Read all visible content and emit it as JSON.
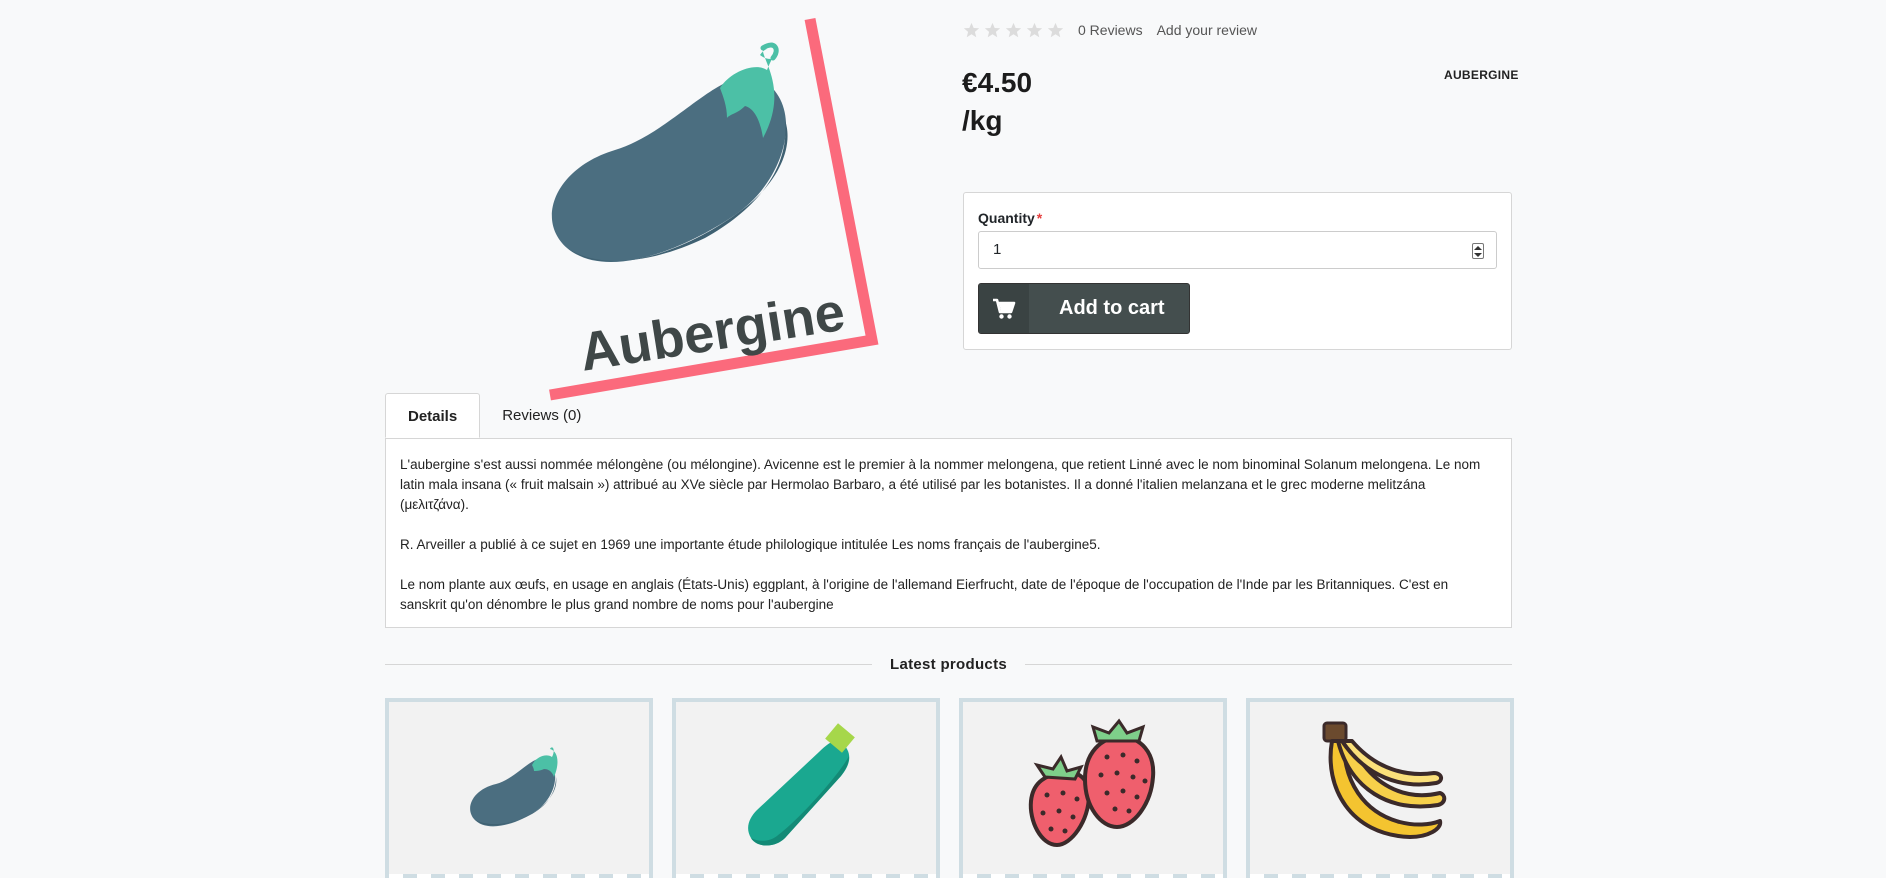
{
  "product": {
    "name": "Aubergine",
    "image_label": "Aubergine",
    "price": "€4.50",
    "price_unit": "/kg",
    "sku": "AUBERGINE"
  },
  "rating": {
    "stars_filled": 0,
    "stars_total": 5,
    "reviews_text": "0 Reviews",
    "add_review_text": "Add your review"
  },
  "cart": {
    "quantity_label": "Quantity",
    "required_marker": "*",
    "quantity_value": "1",
    "add_button_label": "Add to cart"
  },
  "tabs": [
    {
      "label": "Details",
      "active": true
    },
    {
      "label": "Reviews (0)",
      "active": false
    }
  ],
  "details": {
    "paragraphs": [
      "L'aubergine s'est aussi nommée mélongène (ou mélongine). Avicenne est le premier à la nommer melongena, que retient Linné avec le nom binominal Solanum melongena. Le nom latin mala insana (« fruit malsain ») attribué au XVe siècle par Hermolao Barbaro, a été utilisé par les botanistes. Il a donné l'italien melanzana et le grec moderne melitzána (μελιτζάνα).",
      "R. Arveiller a publié à ce sujet en 1969 une importante étude philologique intitulée Les noms français de l'aubergine5.",
      "Le nom plante aux œufs, en usage en anglais (États-Unis) eggplant, à l'origine de l'allemand Eierfrucht, date de l'époque de l'occupation de l'Inde par les Britanniques. C'est en sanskrit qu'on dénombre le plus grand nombre de noms pour l'aubergine"
    ]
  },
  "latest_products": {
    "title": "Latest products",
    "items": [
      {
        "icon": "aubergine-icon"
      },
      {
        "icon": "zucchini-icon"
      },
      {
        "icon": "strawberry-icon"
      },
      {
        "icon": "banana-icon"
      }
    ]
  },
  "colors": {
    "label_border": "#fb6a7c",
    "aubergine_body": "#4b6e80",
    "aubergine_cap": "#4cc0a6",
    "button_bg": "#444e4e",
    "card_border": "#cfdde3"
  }
}
